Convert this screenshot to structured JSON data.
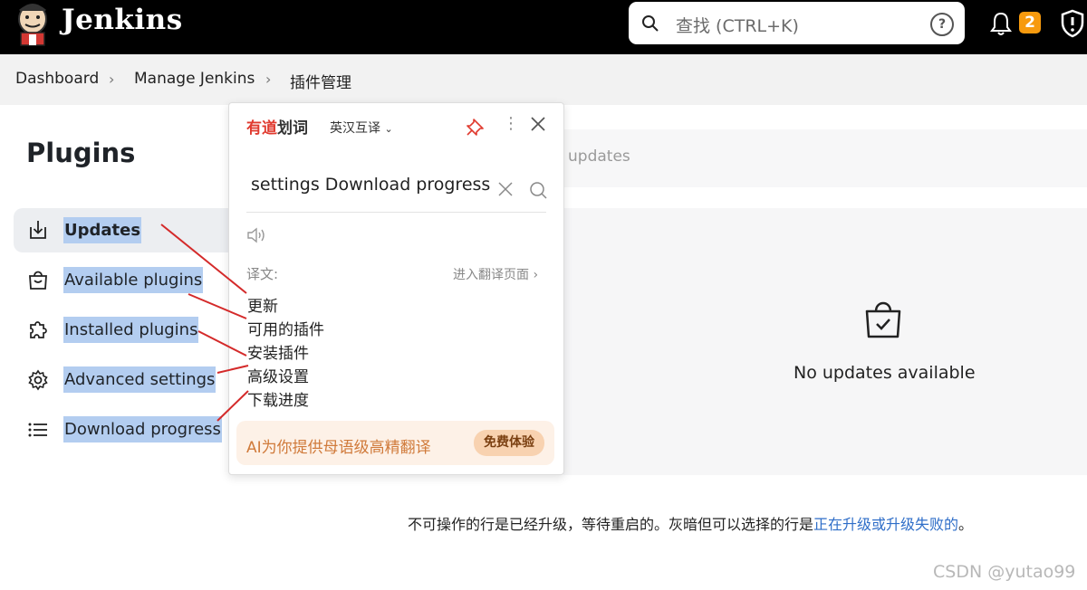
{
  "header": {
    "brand": "Jenkins",
    "search_placeholder": "查找 (CTRL+K)",
    "help_label": "?",
    "notifications_count": "2"
  },
  "breadcrumb": {
    "items": [
      "Dashboard",
      "Manage Jenkins",
      "插件管理"
    ]
  },
  "page": {
    "title": "Plugins"
  },
  "sidebar": {
    "items": [
      {
        "label": "Updates",
        "icon": "download-icon",
        "active": true
      },
      {
        "label": "Available plugins",
        "icon": "shopping-bag-icon"
      },
      {
        "label": "Installed plugins",
        "icon": "puzzle-icon"
      },
      {
        "label": "Advanced settings",
        "icon": "gear-icon"
      },
      {
        "label": "Download progress",
        "icon": "list-icon"
      }
    ]
  },
  "main": {
    "tab_text": "updates",
    "empty_message": "No updates available",
    "footnote_text": "不可操作的行是已经升级，等待重启的。灰暗但可以选择的行是",
    "footnote_link": "正在升级或升级失败的",
    "footnote_end": "。"
  },
  "translator": {
    "brand_part1": "有道",
    "brand_part2": "划词",
    "mode": "英汉互译",
    "query": "settings Download progress",
    "translation_label": "译文:",
    "goto_label": "进入翻译页面",
    "translations": [
      "更新",
      "可用的插件",
      "安装插件",
      "高级设置",
      "下载进度"
    ],
    "ai_promo": "AI为你提供母语级高精翻译",
    "ai_button": "免费体验"
  },
  "watermark": "CSDN @yutao99",
  "colors": {
    "accent_orange": "#f79a0e",
    "selection_blue": "#b3cdf0",
    "annotation_red": "#d42a2a",
    "link_blue": "#2f6ec8"
  }
}
